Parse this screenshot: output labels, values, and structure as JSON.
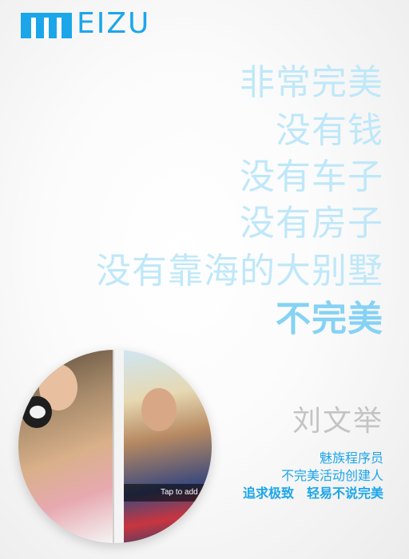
{
  "brand": {
    "logo_text": "MEIZU",
    "logo_rest": "EIZU",
    "color": "#1ca6ea"
  },
  "slogan": {
    "lines": [
      "非常完美",
      "没有钱",
      "没有车子",
      "没有房子",
      "没有靠海的大别墅"
    ],
    "punchline": "不完美",
    "color_light": "#bfe8f9",
    "color_bold": "#85d2f5"
  },
  "photo": {
    "overlay_text": "Tap to add"
  },
  "profile": {
    "name": "刘文举",
    "roles": [
      "魅族程序员",
      "不完美活动创建人"
    ],
    "motto": "追求极致　轻易不说完美"
  }
}
